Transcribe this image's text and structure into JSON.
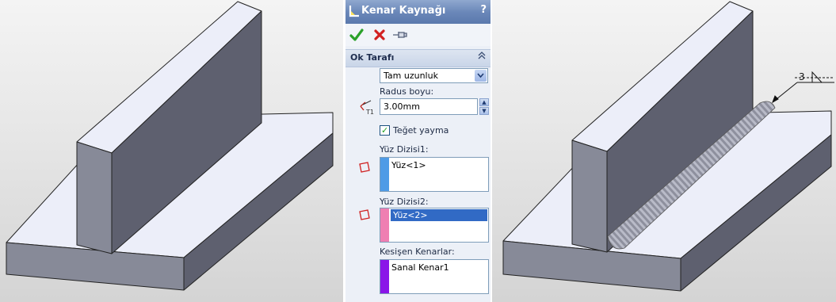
{
  "panel": {
    "title": "Kenar Kaynağı",
    "help": "?",
    "toolbar": {
      "ok": "ok-icon",
      "cancel": "cancel-icon",
      "pin": "pushpin-icon"
    },
    "section": {
      "title": "Ok Tarafı"
    },
    "length_mode": {
      "selected": "Tam uzunluk"
    },
    "radius": {
      "label": "Radus boyu:",
      "value": "3.00mm"
    },
    "tangent": {
      "label": "Teğet yayma",
      "checked": true
    },
    "face_set1": {
      "label": "Yüz Dizisi1:",
      "items": [
        "Yüz<1>"
      ],
      "color": "#4f9be6"
    },
    "face_set2": {
      "label": "Yüz Dizisi2:",
      "items": [
        "Yüz<2>"
      ],
      "color": "#ef7fb2"
    },
    "intersecting_edges": {
      "label": "Kesişen Kenarlar:",
      "items": [
        "Sanal Kenar1"
      ],
      "color": "#8a16e8"
    }
  },
  "weld_symbol": {
    "size": "3"
  },
  "colors": {
    "title_bar": "#6b88b9",
    "part_face_light": "#e8ebf8",
    "part_face_dark": "#5d5f70",
    "part_face_mid": "#878a97"
  }
}
